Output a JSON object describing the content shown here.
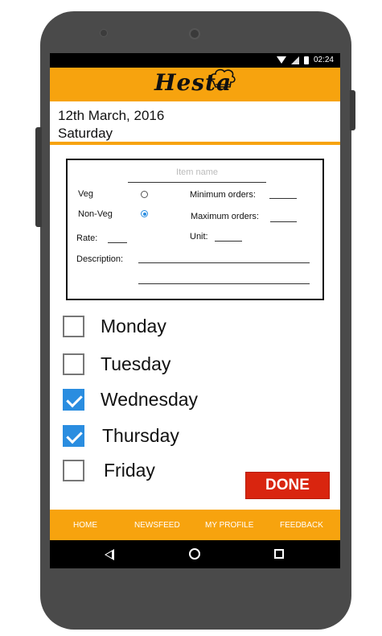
{
  "status_bar": {
    "time": "02:24",
    "icons": [
      "wifi-icon",
      "signal-icon",
      "battery-icon"
    ]
  },
  "header": {
    "logo_text": "Hesta",
    "logo_icon": "chef-hat-icon",
    "color": "#f7a30e"
  },
  "date": {
    "line1": "12th March, 2016",
    "line2": "Saturday"
  },
  "form": {
    "item_name_placeholder": "Item name",
    "veg_label": "Veg",
    "veg_selected": false,
    "nonveg_label": "Non-Veg",
    "nonveg_selected": true,
    "min_orders_label": "Minimum orders:",
    "max_orders_label": "Maximum orders:",
    "rate_label": "Rate:",
    "unit_label": "Unit:",
    "description_label": "Description:"
  },
  "days": [
    {
      "label": "Monday",
      "checked": false
    },
    {
      "label": "Tuesday",
      "checked": false
    },
    {
      "label": "Wednesday",
      "checked": true
    },
    {
      "label": "Thursday",
      "checked": true
    },
    {
      "label": "Friday",
      "checked": false
    }
  ],
  "done_button": {
    "label": "DONE",
    "color": "#d9250f"
  },
  "bottom_nav": {
    "items": [
      "HOME",
      "NEWSFEED",
      "MY PROFILE",
      "FEEDBACK"
    ]
  },
  "system_nav": {
    "icons": [
      "back-icon",
      "home-icon",
      "recents-icon"
    ]
  },
  "accent_checkbox_color": "#2a8de0"
}
